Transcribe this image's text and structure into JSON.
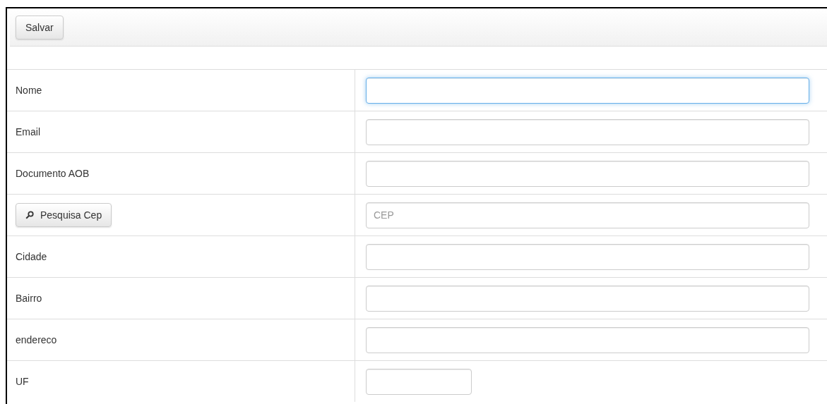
{
  "toolbar": {
    "buttons": [
      "Salvar"
    ]
  },
  "rows": [
    {
      "kind": "label",
      "label": "Nome",
      "field": {
        "focused": true,
        "kind": "wide"
      }
    },
    {
      "kind": "label",
      "label": "Email",
      "field": {
        "focused": false,
        "kind": "wide"
      }
    },
    {
      "kind": "label",
      "label": "Documento AOB",
      "field": {
        "focused": false,
        "kind": "wide"
      }
    },
    {
      "kind": "button",
      "label": "Pesquisa Cep",
      "field": {
        "focused": false,
        "kind": "wide",
        "placeholder": "CEP"
      }
    },
    {
      "kind": "label",
      "label": "Cidade",
      "field": {
        "focused": false,
        "kind": "wide"
      }
    },
    {
      "kind": "label",
      "label": "Bairro",
      "field": {
        "focused": false,
        "kind": "wide"
      }
    },
    {
      "kind": "label",
      "label": "endereco",
      "field": {
        "focused": false,
        "kind": "wide"
      }
    },
    {
      "kind": "label",
      "label": "UF",
      "field": {
        "focused": false,
        "kind": "narrow"
      }
    }
  ]
}
